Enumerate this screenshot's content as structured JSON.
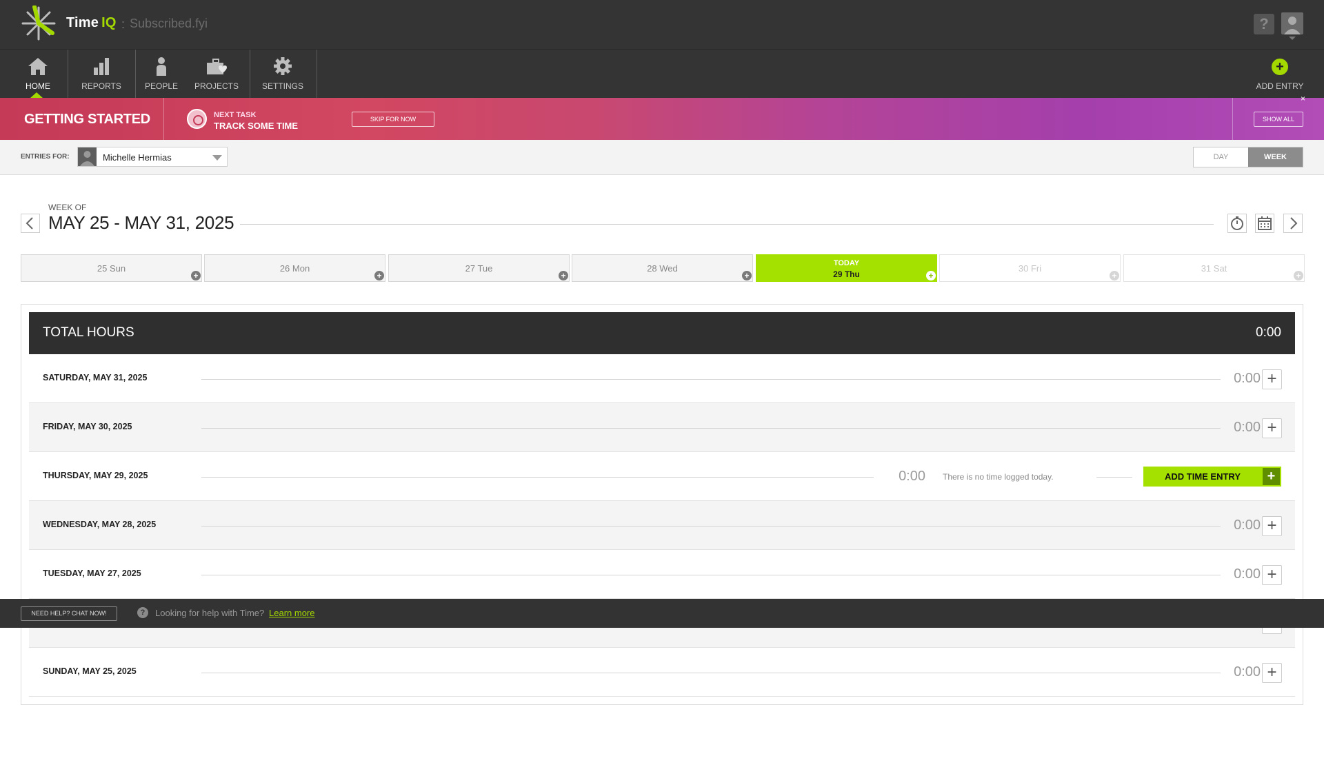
{
  "app": {
    "name": "Time",
    "name_accent": "IQ",
    "separator": ":",
    "subtitle": "Subscribed.fyi"
  },
  "topbar": {
    "help_label": "?"
  },
  "nav": {
    "items": [
      {
        "label": "HOME",
        "icon": "home-icon"
      },
      {
        "label": "REPORTS",
        "icon": "bar-chart-icon"
      },
      {
        "label": "PEOPLE",
        "icon": "person-icon"
      },
      {
        "label": "PROJECTS",
        "icon": "briefcase-heart-icon"
      },
      {
        "label": "SETTINGS",
        "icon": "gear-icon"
      }
    ],
    "add_entry": {
      "label": "ADD ENTRY",
      "icon": "plus-circle-icon",
      "symbol": "+"
    }
  },
  "getting_started": {
    "title": "GETTING STARTED",
    "next_label": "NEXT TASK",
    "next_task": "TRACK SOME TIME",
    "skip_label": "SKIP FOR NOW",
    "show_all_label": "SHOW ALL",
    "close_symbol": "×"
  },
  "entries_for": {
    "label": "ENTRIES FOR:",
    "selected_user": "Michelle Hermias"
  },
  "view_toggle": {
    "day": "DAY",
    "week": "WEEK",
    "active": "WEEK"
  },
  "week": {
    "label": "WEEK OF",
    "range": "MAY 25 - MAY 31, 2025"
  },
  "day_tabs": [
    {
      "label": "25 Sun",
      "state": "past"
    },
    {
      "label": "26 Mon",
      "state": "past"
    },
    {
      "label": "27 Tue",
      "state": "past"
    },
    {
      "label": "28 Wed",
      "state": "past"
    },
    {
      "label": "29 Thu",
      "state": "today",
      "today_label": "TODAY"
    },
    {
      "label": "30 Fri",
      "state": "future"
    },
    {
      "label": "31 Sat",
      "state": "future"
    }
  ],
  "tab_plus_symbol": "+",
  "total_hours": {
    "label": "TOTAL HOURS",
    "value": "0:00"
  },
  "days": [
    {
      "label": "SATURDAY, MAY 31, 2025",
      "hours": "0:00"
    },
    {
      "label": "FRIDAY, MAY 30, 2025",
      "hours": "0:00"
    },
    {
      "label": "THURSDAY, MAY 29, 2025",
      "hours": "0:00",
      "today": true,
      "empty_message": "There is no time logged today.",
      "add_label": "ADD TIME ENTRY"
    },
    {
      "label": "WEDNESDAY, MAY 28, 2025",
      "hours": "0:00"
    },
    {
      "label": "TUESDAY, MAY 27, 2025",
      "hours": "0:00"
    },
    {
      "label": "SUNDAY, MAY 25, 2025",
      "hours": "0:00"
    }
  ],
  "row_plus_symbol": "+",
  "help_bar": {
    "chat_label": "NEED HELP? CHAT NOW!",
    "question_symbol": "?",
    "text": "Looking for help with Time?",
    "link": "Learn more"
  },
  "colors": {
    "accent": "#a4d900",
    "topbar": "#343434",
    "banner_start": "#c43a57",
    "banner_end": "#b24cb6"
  }
}
